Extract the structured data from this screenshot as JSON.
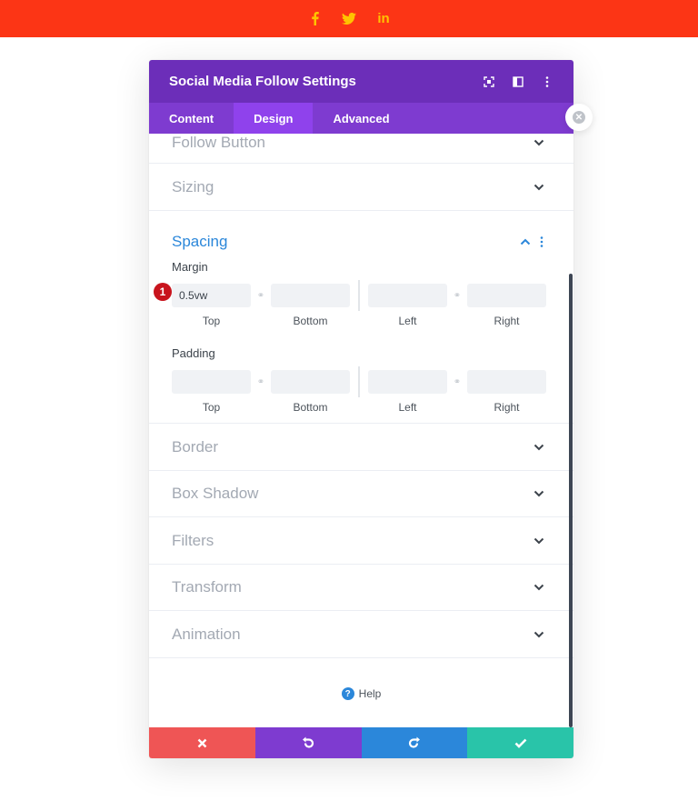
{
  "topbar": {
    "bg_color": "#fc3515",
    "icon_color": "#ffc300",
    "icons": [
      "facebook-icon",
      "twitter-icon",
      "linkedin-icon"
    ],
    "linkedin_text": "in"
  },
  "modal": {
    "title": "Social Media Follow Settings",
    "header_color": "#6c2eb9",
    "tabs": [
      {
        "label": "Content"
      },
      {
        "label": "Design"
      },
      {
        "label": "Advanced"
      }
    ],
    "active_tab": "Design"
  },
  "sections": {
    "follow_button": "Follow Button",
    "sizing": "Sizing",
    "spacing": "Spacing",
    "border": "Border",
    "box_shadow": "Box Shadow",
    "filters": "Filters",
    "transform": "Transform",
    "animation": "Animation"
  },
  "spacing": {
    "margin": {
      "label": "Margin",
      "top": "0.5vw",
      "bottom": "",
      "left": "",
      "right": "",
      "captions": [
        "Top",
        "Bottom",
        "Left",
        "Right"
      ]
    },
    "padding": {
      "label": "Padding",
      "top": "",
      "bottom": "",
      "left": "",
      "right": "",
      "captions": [
        "Top",
        "Bottom",
        "Left",
        "Right"
      ]
    },
    "badge": "1"
  },
  "help": {
    "label": "Help"
  },
  "footer": {
    "colors": [
      "#ef5555",
      "#7e3bd0",
      "#2b87da",
      "#29c4a9"
    ],
    "buttons": [
      "close-icon",
      "undo-icon",
      "redo-icon",
      "save-check-icon"
    ]
  }
}
